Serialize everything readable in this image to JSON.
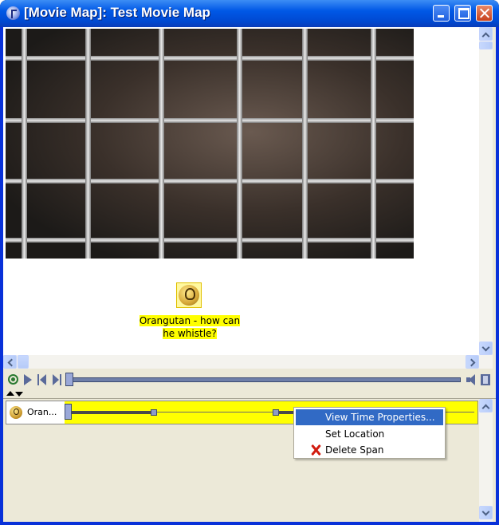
{
  "window": {
    "title": "[Movie Map]: Test Movie Map",
    "buttons": [
      "minimize",
      "maximize",
      "close"
    ]
  },
  "stage": {
    "video_alt": "orangutan behind cage wire",
    "annotation": {
      "icon": "lightbulb-icon",
      "label": "Orangutan - how can he whistle?"
    }
  },
  "transport": {
    "icons": [
      "record-icon",
      "play-icon",
      "step-back-icon",
      "step-forward-icon",
      "volume-icon",
      "film-icon"
    ]
  },
  "timeline": {
    "rows": [
      {
        "label": "Oran...",
        "icon": "lightbulb-icon",
        "span_color": "#ffff00"
      }
    ]
  },
  "context_menu": {
    "items": [
      {
        "label": "View Time Properties...",
        "selected": true
      },
      {
        "label": "Set Location",
        "selected": false
      },
      {
        "label": "Delete Span",
        "icon": "delete-x-icon",
        "selected": false
      }
    ]
  },
  "colors": {
    "titlebar": "#0058e6",
    "selection": "#316ac5",
    "span_highlight": "#ffff00",
    "panel_bg": "#ece9d8"
  }
}
